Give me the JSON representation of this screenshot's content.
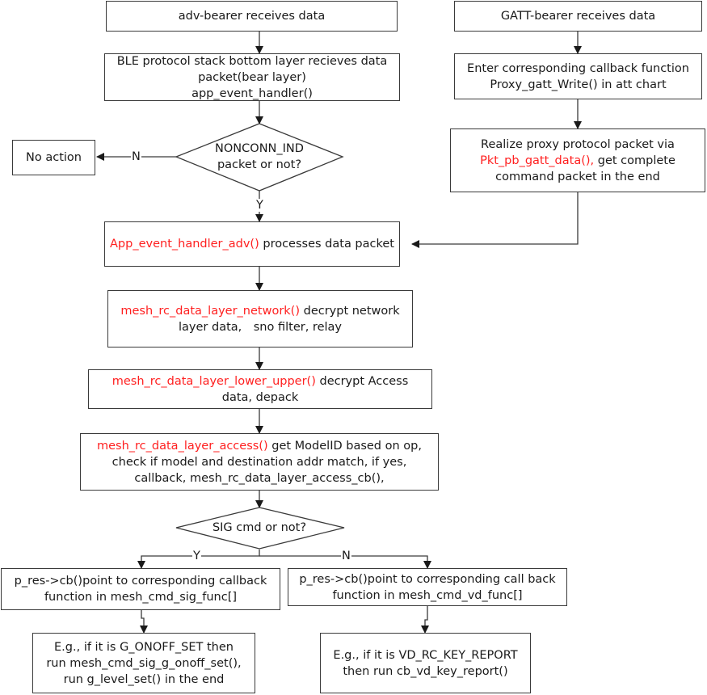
{
  "nodes": {
    "adv_bearer": {
      "text": "adv-bearer receives data"
    },
    "gatt_bearer": {
      "text": "GATT-bearer receives data"
    },
    "ble_stack": {
      "line1": "BLE protocol stack bottom layer recieves data",
      "line2": "packet(bear layer)",
      "line3": "app_event_handler()"
    },
    "enter_callback": {
      "line1": "Enter corresponding callback function",
      "line2": "Proxy_gatt_Write() in att chart"
    },
    "realize_proxy": {
      "line1": "Realize proxy protocol packet via",
      "line2_red": "Pkt_pb_gatt_data(),",
      "line2_rest": " get complete",
      "line3": "command packet in the end"
    },
    "nonconn_decision": {
      "line1": "NONCONN_IND",
      "line2": "packet or not?"
    },
    "no_action": {
      "text": "No action"
    },
    "app_event_adv": {
      "red": "App_event_handler_adv()",
      "rest": " processes data packet"
    },
    "network_layer": {
      "red": "mesh_rc_data_layer_network()",
      "rest": " decrypt network",
      "line2": "layer data,　sno filter, relay"
    },
    "lower_upper": {
      "red": "mesh_rc_data_layer_lower_upper()",
      "rest": " decrypt Access",
      "line2": "data, depack"
    },
    "access_layer": {
      "red": "mesh_rc_data_layer_access()",
      "rest": " get ModelID based on op,",
      "line2": "check if model and destination addr match, if yes,",
      "line3": "callback, mesh_rc_data_layer_access_cb(),"
    },
    "sig_decision": {
      "text": "SIG cmd or not?"
    },
    "sig_func": {
      "line1": "p_res->cb()point to corresponding callback",
      "line2": "function in mesh_cmd_sig_func[]"
    },
    "vd_func": {
      "line1": "p_res->cb()point to corresponding call back",
      "line2": "function in mesh_cmd_vd_func[]"
    },
    "sig_example": {
      "line1": "E.g., if it is G_ONOFF_SET then",
      "line2": "run mesh_cmd_sig_g_onoff_set(),",
      "line3": "run g_level_set() in the end"
    },
    "vd_example": {
      "line1": "E.g., if it is VD_RC_KEY_REPORT",
      "line2": "then run cb_vd_key_report()"
    }
  },
  "edge_labels": {
    "nonconn_no": "N",
    "nonconn_yes": "Y",
    "sig_yes": "Y",
    "sig_no": "N"
  },
  "colors": {
    "highlight": "#ff2020",
    "line": "#3a3a3a"
  }
}
